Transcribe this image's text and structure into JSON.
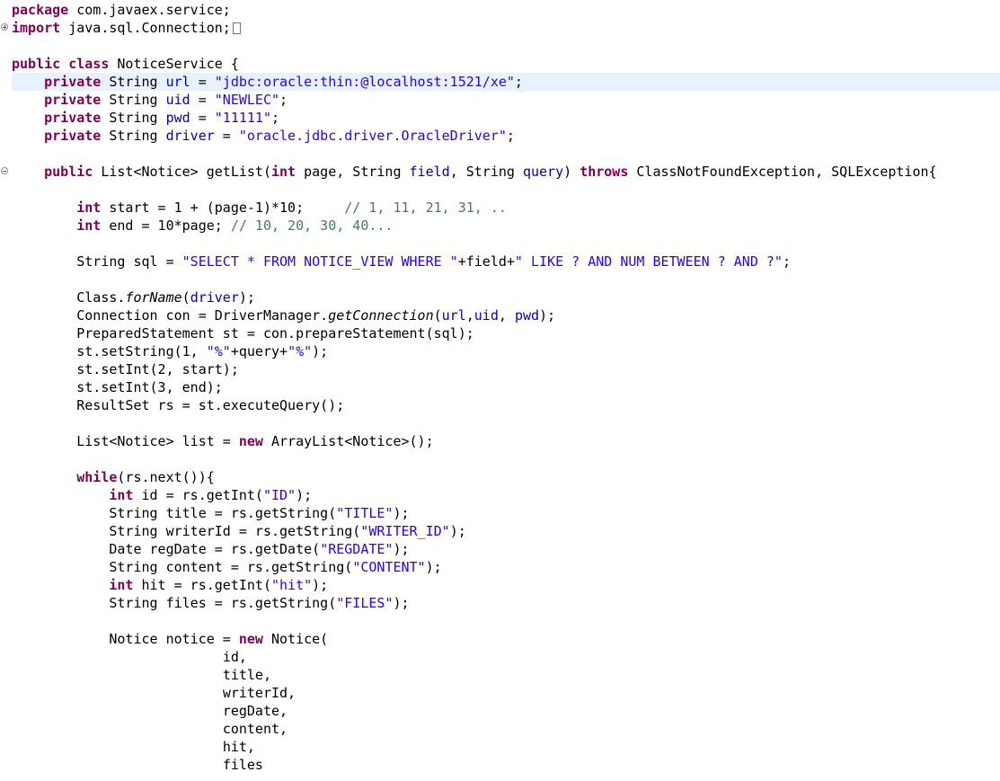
{
  "colors": {
    "keyword": "#7f0055",
    "field": "#0000c0",
    "string": "#2a00ff",
    "comment": "#3f7f5f",
    "current_line": "#e8f2fe"
  },
  "gutter_icons": [
    "expand-fold-icon",
    "collapse-fold-icon"
  ],
  "code": {
    "line1": {
      "kw": "package",
      "rest": " com.javaex.service;"
    },
    "line2": {
      "kw": "import",
      "rest": " java.sql.Connection;"
    },
    "line3": {
      "kw1": "public",
      "kw2": "class",
      "rest": " NoticeService {"
    },
    "line4": {
      "kw": "private",
      "type": " String ",
      "name": "url",
      "eq": " = ",
      "str": "\"jdbc:oracle:thin:@localhost:1521/xe\"",
      "end": ";"
    },
    "line5": {
      "kw": "private",
      "type": " String ",
      "name": "uid",
      "eq": " = ",
      "str": "\"NEWLEC\"",
      "end": ";"
    },
    "line6": {
      "kw": "private",
      "type": " String ",
      "name": "pwd",
      "eq": " = ",
      "str": "\"11111\"",
      "end": ";"
    },
    "line7": {
      "kw": "private",
      "type": " String ",
      "name": "driver",
      "eq": " = ",
      "str": "\"oracle.jdbc.driver.OracleDriver\"",
      "end": ";"
    },
    "line8": {
      "kw": "public",
      "p1": " List<Notice> getList(",
      "kw_int": "int",
      "p2": " page, String ",
      "field": "field",
      "p3": ", String ",
      "query": "query",
      "p4": ") ",
      "kw_throws": "throws",
      "p5": " ClassNotFoundException, SQLException{"
    },
    "line9": {
      "kw": "int",
      "p1": " start = 1 + (page-1)*10;",
      "cmt": "// 1, 11, 21, 31, .."
    },
    "line10": {
      "kw": "int",
      "p1": " end = 10*page; ",
      "cmt": "// 10, 20, 30, 40..."
    },
    "line11": {
      "p1": "String sql = ",
      "s1": "\"SELECT * FROM NOTICE_VIEW WHERE \"",
      "p2": "+field+",
      "s2": "\" LIKE ? AND NUM BETWEEN ? AND ?\"",
      "end": ";"
    },
    "line12": {
      "p1": "Class.",
      "method": "forName",
      "p2": "(",
      "field": "driver",
      "p3": ");"
    },
    "line13": {
      "p1": "Connection con = DriverManager.",
      "method": "getConnection",
      "p2": "(",
      "f1": "url",
      "c1": ",",
      "f2": "uid",
      "c2": ", ",
      "f3": "pwd",
      "p3": ");"
    },
    "line14": {
      "text": "PreparedStatement st = con.prepareStatement(sql);"
    },
    "line15": {
      "p1": "st.setString(1, ",
      "s1": "\"%\"",
      "p2": "+query+",
      "s2": "\"%\"",
      "p3": ");"
    },
    "line16": {
      "text": "st.setInt(2, start);"
    },
    "line17": {
      "text": "st.setInt(3, end);"
    },
    "line18": {
      "text": "ResultSet rs = st.executeQuery();"
    },
    "line19": {
      "p1": "List<Notice> list = ",
      "kw": "new",
      "p2": " ArrayList<Notice>();"
    },
    "line20": {
      "kw": "while",
      "rest": "(rs.next()){"
    },
    "line21": {
      "kw": "int",
      "p1": " id = rs.getInt(",
      "str": "\"ID\"",
      "end": ");"
    },
    "line22": {
      "p1": "String title = rs.getString(",
      "str": "\"TITLE\"",
      "end": ");"
    },
    "line23": {
      "p1": "String writerId = rs.getString(",
      "str": "\"WRITER_ID\"",
      "end": ");"
    },
    "line24": {
      "p1": "Date regDate = rs.getDate(",
      "str": "\"REGDATE\"",
      "end": ");"
    },
    "line25": {
      "p1": "String content = rs.getString(",
      "str": "\"CONTENT\"",
      "end": ");"
    },
    "line26": {
      "kw": "int",
      "p1": " hit = rs.getInt(",
      "str": "\"hit\"",
      "end": ");"
    },
    "line27": {
      "p1": "String files = rs.getString(",
      "str": "\"FILES\"",
      "end": ");"
    },
    "line28": {
      "p1": "Notice notice = ",
      "kw": "new",
      "p2": " Notice("
    },
    "line29": {
      "text": "id,"
    },
    "line30": {
      "text": "title,"
    },
    "line31": {
      "text": "writerId,"
    },
    "line32": {
      "text": "regDate,"
    },
    "line33": {
      "text": "content,"
    },
    "line34": {
      "text": "hit,"
    },
    "line35": {
      "text": "files"
    }
  }
}
